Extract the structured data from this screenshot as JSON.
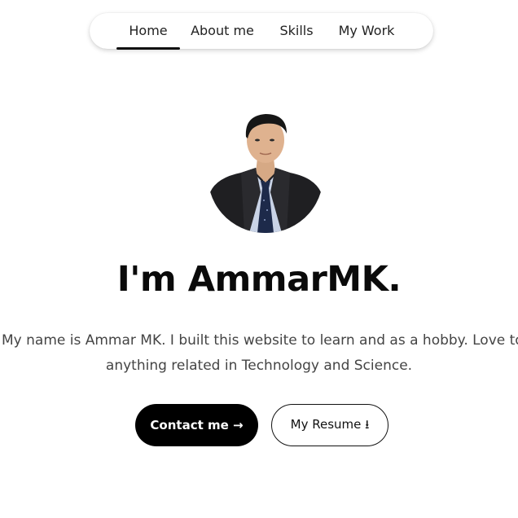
{
  "nav": {
    "items": [
      {
        "label": "Home",
        "active": true
      },
      {
        "label": "About me",
        "active": false
      },
      {
        "label": "Skills",
        "active": false
      },
      {
        "label": "My Work",
        "active": false
      }
    ]
  },
  "hero": {
    "title": "I'm AmmarMK.",
    "description_line1": "My name is Ammar MK. I built this website to learn and as a hobby. Love to do",
    "description_line2": "anything related in Technology and Science."
  },
  "buttons": {
    "contact_label": "Contact me →",
    "resume_label": "My Resume ⭳"
  },
  "colors": {
    "primary": "#000000",
    "background": "#ffffff",
    "text": "#111111"
  }
}
